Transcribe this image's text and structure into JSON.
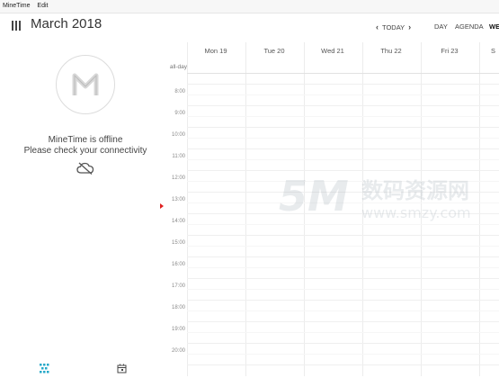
{
  "menubar": {
    "app_name": "MineTime",
    "edit": "Edit"
  },
  "header": {
    "menu_icon": "hamburger-icon",
    "month_title": "March 2018",
    "today_label": "TODAY",
    "views": [
      "DAY",
      "AGENDA",
      "WE"
    ]
  },
  "sidebar": {
    "logo_icon": "minetime-logo-icon",
    "offline_title": "MineTime is offline",
    "offline_message": "Please check your connectivity",
    "offline_icon": "cloud-off-icon",
    "bottom_icons": [
      "tasks-icon",
      "calendar-icon"
    ]
  },
  "calendar": {
    "days": [
      "Mon 19",
      "Tue 20",
      "Wed 21",
      "Thu 22",
      "Fri 23",
      "S"
    ],
    "allday_label": "all-day",
    "times": [
      "8:00",
      "9:00",
      "10:00",
      "11:00",
      "12:00",
      "13:00",
      "14:00",
      "15:00",
      "16:00",
      "17:00",
      "18:00",
      "19:00",
      "20:00"
    ]
  },
  "watermark": {
    "logo": "5M",
    "cn_text": "数码资源网",
    "url": "www.smzy.com"
  },
  "colors": {
    "now_indicator": "#e02020",
    "accent": "#27a9c9"
  }
}
